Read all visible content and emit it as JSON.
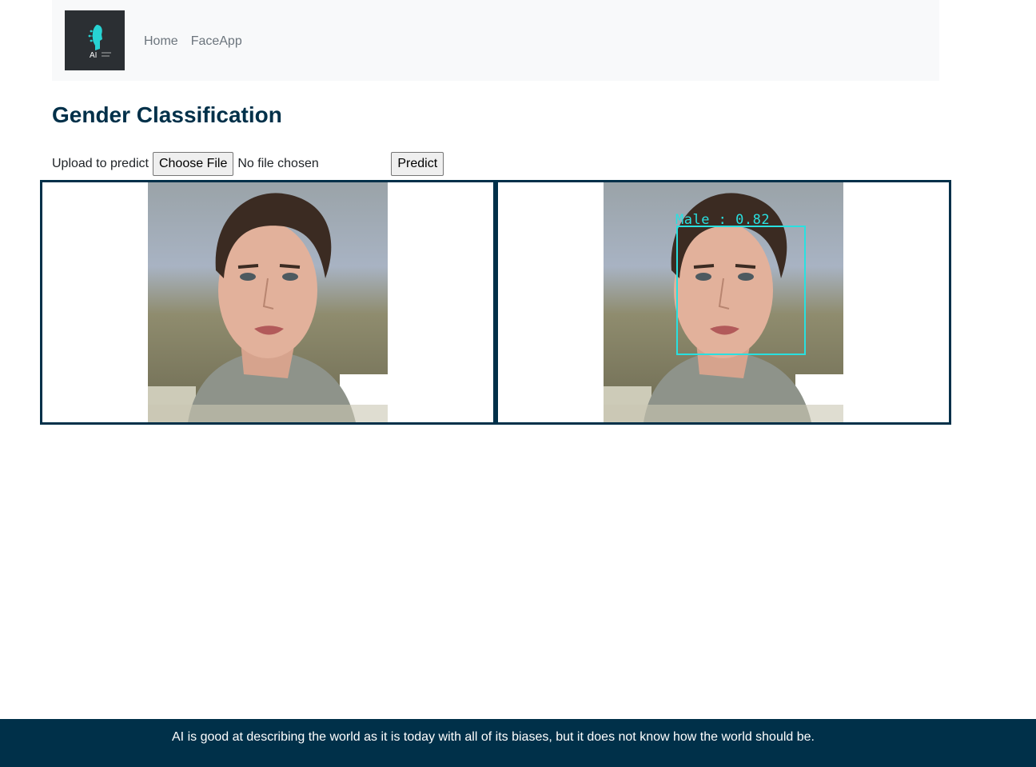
{
  "navbar": {
    "logo_text": "AI",
    "links": [
      {
        "label": "Home"
      },
      {
        "label": "FaceApp"
      }
    ]
  },
  "page": {
    "title": "Gender Classification"
  },
  "form": {
    "label": "Upload to predict",
    "choose_file_label": "Choose File",
    "file_status": "No file chosen",
    "predict_label": "Predict"
  },
  "result": {
    "prediction_label": "Male : 0.82",
    "box_color": "#29e0e0"
  },
  "footer": {
    "text": "AI is good at describing the world as it is today with all of its biases, but it does not know how the world should be."
  },
  "colors": {
    "primary": "#003049",
    "navbar_bg": "#f8f9fa",
    "nav_link": "#6c757d"
  }
}
